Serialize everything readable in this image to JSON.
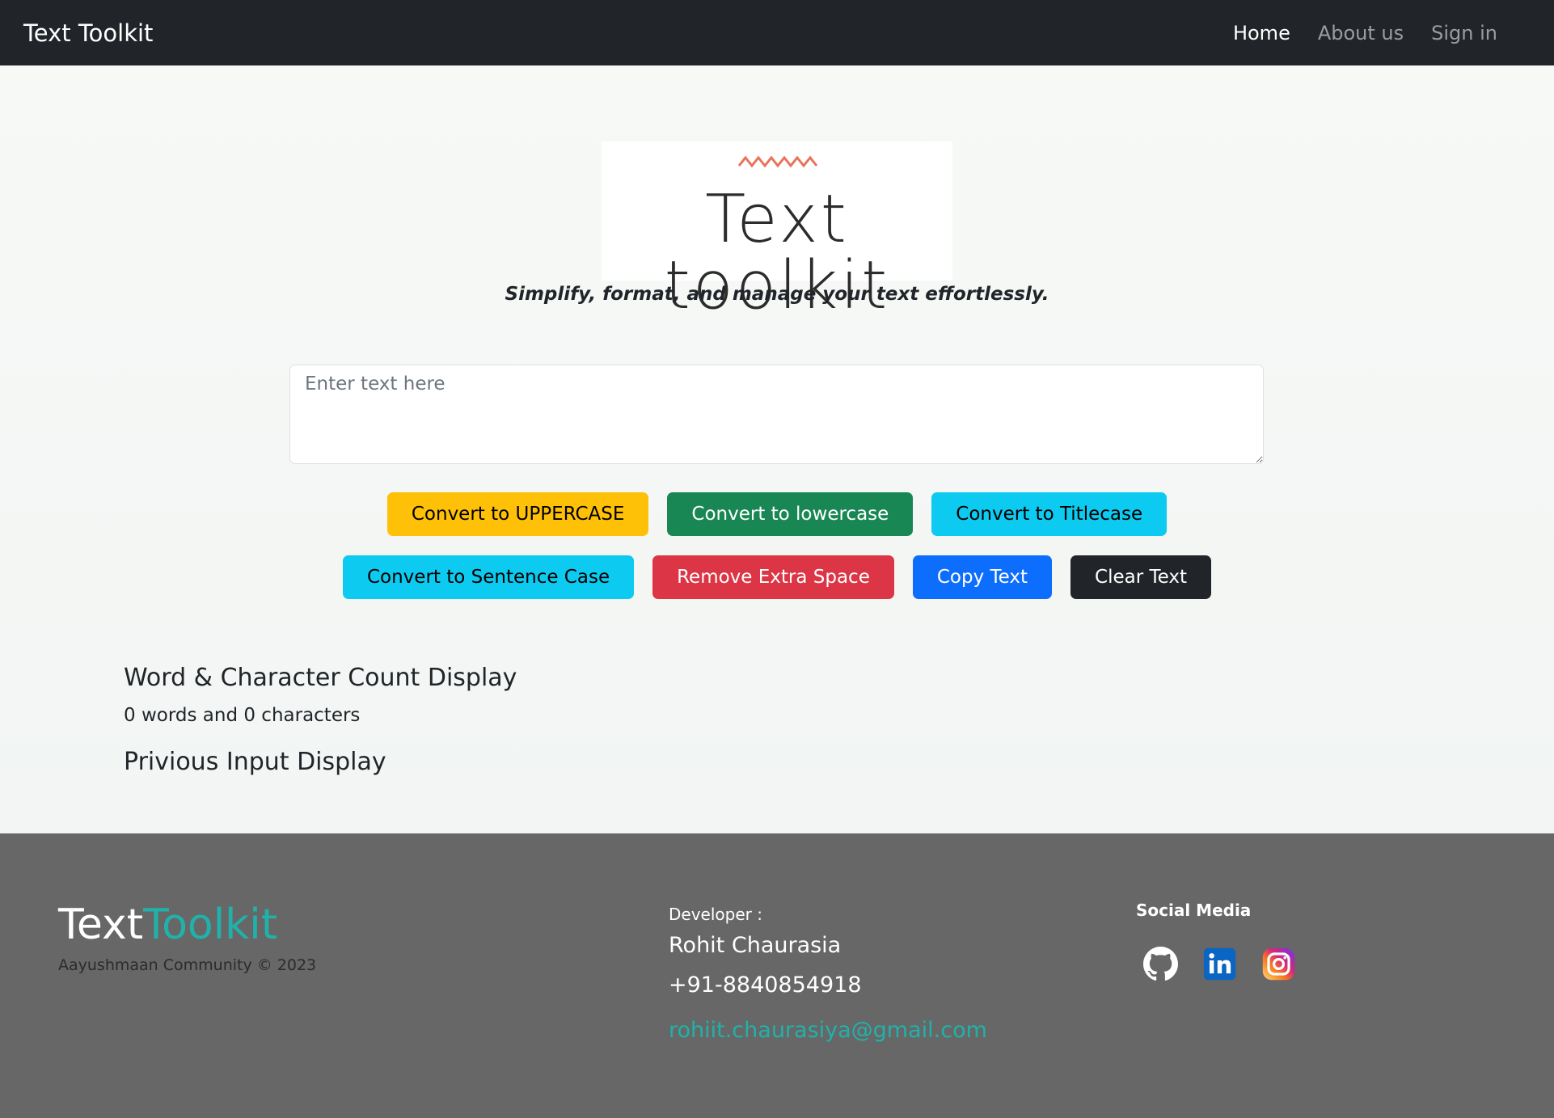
{
  "navbar": {
    "brand": "Text Toolkit",
    "links": [
      {
        "label": "Home",
        "active": true
      },
      {
        "label": "About us",
        "active": false
      },
      {
        "label": "Sign in",
        "active": false
      }
    ]
  },
  "hero": {
    "logo_text": "Text toolkit",
    "tagline": "Simplify, format, and manage your text effortlessly."
  },
  "editor": {
    "placeholder": "Enter text here",
    "value": ""
  },
  "buttons": {
    "uppercase": "Convert to UPPERCASE",
    "lowercase": "Convert to lowercase",
    "titlecase": "Convert to Titlecase",
    "sentencecase": "Convert to Sentence Case",
    "remove_space": "Remove Extra Space",
    "copy": "Copy Text",
    "clear": "Clear Text"
  },
  "summary": {
    "count_title": "Word & Character Count Display",
    "count_text": "0 words and 0 characters",
    "previous_title": "Privious Input Display"
  },
  "footer": {
    "brand_part1": "Text",
    "brand_part2": "Toolkit",
    "copyright": "Aayushmaan Community © 2023",
    "developer_label": "Developer :",
    "developer_name": "Rohit Chaurasia",
    "developer_phone": "+91-8840854918",
    "developer_email": "rohiit.chaurasiya@gmail.com",
    "social_title": "Social Media",
    "social_icons": [
      "github-icon",
      "linkedin-icon",
      "instagram-icon"
    ]
  },
  "colors": {
    "navbar_bg": "#212529",
    "footer_bg": "#676767",
    "accent_teal": "#20b2aa",
    "logo_zigzag": "#e8735a"
  }
}
